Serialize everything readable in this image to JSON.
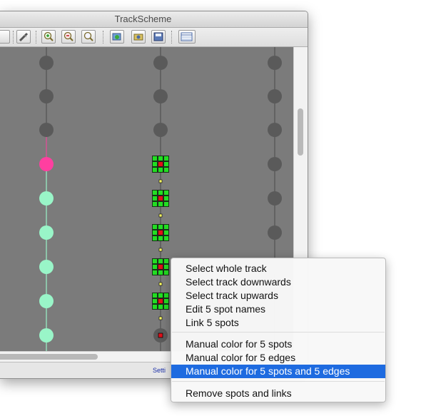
{
  "window": {
    "title": "TrackScheme"
  },
  "toolbar": {
    "buttons": [
      {
        "name": "partial-left-button",
        "icon": "button-icon"
      },
      {
        "name": "style-button",
        "icon": "pen-icon"
      },
      {
        "name": "zoom-in-button",
        "icon": "zoom-in-icon"
      },
      {
        "name": "zoom-out-button",
        "icon": "zoom-out-icon"
      },
      {
        "name": "zoom-fit-button",
        "icon": "magnifier-icon"
      },
      {
        "name": "refresh-button",
        "icon": "refresh-icon"
      },
      {
        "name": "capture-button",
        "icon": "camera-icon"
      },
      {
        "name": "export-button",
        "icon": "save-icon"
      },
      {
        "name": "display-settings-button",
        "icon": "table-icon"
      }
    ]
  },
  "status": {
    "settings_link": "Setti"
  },
  "context_menu": {
    "group1": [
      "Select whole track",
      "Select track downwards",
      "Select track upwards",
      "Edit 5 spot names",
      "Link 5 spots"
    ],
    "group2": [
      "Manual color for 5 spots",
      "Manual color for 5 edges",
      "Manual color for 5 spots and 5 edges"
    ],
    "group3": [
      "Remove spots and links"
    ],
    "highlighted": "Manual color for 5 spots and 5 edges"
  },
  "colors": {
    "canvas_bg": "#7b7b7b",
    "spot_default": "#5a5a5a",
    "spot_selected_magenta": "#ff3fa0",
    "spot_colored_mint": "#99f5c8",
    "selection_handle": "#22dd22",
    "selected_spot_core": "#e0101a",
    "menu_highlight": "#1e6be0"
  }
}
